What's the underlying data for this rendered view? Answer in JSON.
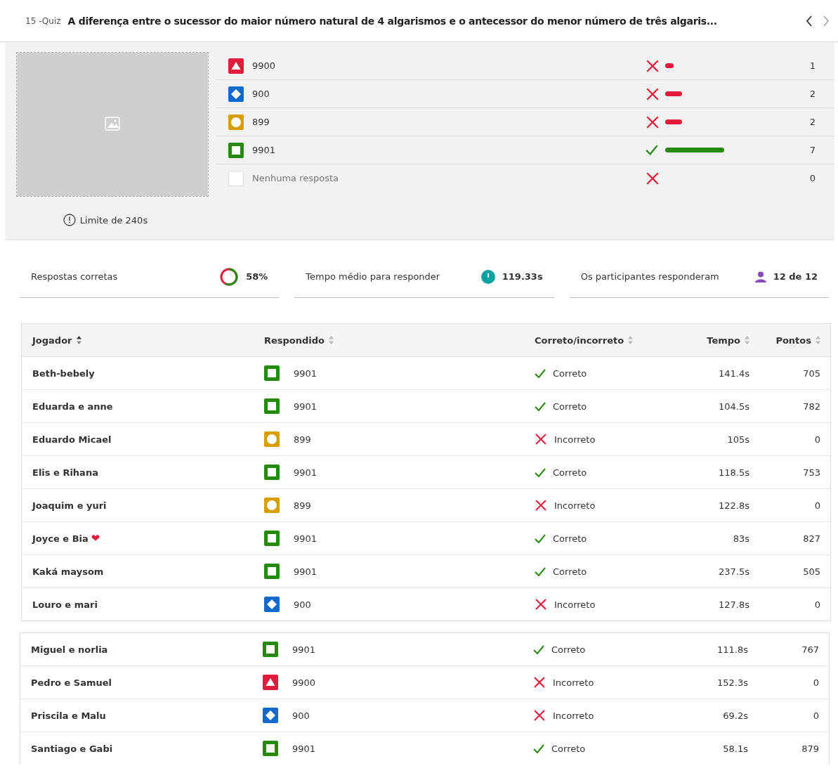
{
  "header": {
    "number": "15 -Quiz",
    "title": "A diferença entre o sucessor do maior número natural de 4 algarismos e o antecessor do menor número de três algaris..."
  },
  "question": {
    "time_limit": "Limite de 240s",
    "answers": [
      {
        "kind": "triangle",
        "color": "#e21b3c",
        "text": "9900",
        "correct": false,
        "count": "1"
      },
      {
        "kind": "diamond",
        "color": "#1368ce",
        "text": "900",
        "correct": false,
        "count": "2"
      },
      {
        "kind": "circle",
        "color": "#d89e00",
        "text": "899",
        "correct": false,
        "count": "2"
      },
      {
        "kind": "square",
        "color": "#26890c",
        "text": "9901",
        "correct": true,
        "count": "7"
      },
      {
        "kind": "none",
        "color": "#ffffff",
        "text": "Nenhuma resposta",
        "correct": false,
        "count": "0"
      }
    ]
  },
  "stats": [
    {
      "kind": "donut",
      "label": "Respostas corretas",
      "value": "58%"
    },
    {
      "kind": "clock",
      "label": "Tempo médio para responder",
      "value": "119.33s"
    },
    {
      "kind": "person",
      "label": "Os participantes responderam",
      "value": "12 de 12"
    }
  ],
  "table": {
    "columns": [
      {
        "label": "Jogador",
        "sorted": true
      },
      {
        "label": "Respondido",
        "sorted": false
      },
      {
        "label": "Correto/incorreto",
        "sorted": false
      },
      {
        "label": "Tempo",
        "sorted": false
      },
      {
        "label": "Pontos",
        "sorted": false
      }
    ],
    "rows": [
      {
        "player": "Beth-bebely",
        "kind": "square",
        "color": "#26890c",
        "answer": "9901",
        "correct": true,
        "result": "Correto",
        "time": "141.4s",
        "points": "705"
      },
      {
        "player": "Eduarda e anne",
        "kind": "square",
        "color": "#26890c",
        "answer": "9901",
        "correct": true,
        "result": "Correto",
        "time": "104.5s",
        "points": "782"
      },
      {
        "player": "Eduardo Micael",
        "kind": "circle",
        "color": "#d89e00",
        "answer": "899",
        "correct": false,
        "result": "Incorreto",
        "time": "105s",
        "points": "0"
      },
      {
        "player": "Elis e Rihana",
        "kind": "square",
        "color": "#26890c",
        "answer": "9901",
        "correct": true,
        "result": "Correto",
        "time": "118.5s",
        "points": "753"
      },
      {
        "player": "Joaquim e yuri",
        "kind": "circle",
        "color": "#d89e00",
        "answer": "899",
        "correct": false,
        "result": "Incorreto",
        "time": "122.8s",
        "points": "0"
      },
      {
        "player": "Joyce e Bia",
        "suffix": "❤",
        "kind": "square",
        "color": "#26890c",
        "answer": "9901",
        "correct": true,
        "result": "Correto",
        "time": "83s",
        "points": "827"
      },
      {
        "player": "Kaká maysom",
        "kind": "square",
        "color": "#26890c",
        "answer": "9901",
        "correct": true,
        "result": "Correto",
        "time": "237.5s",
        "points": "505"
      },
      {
        "player": "Louro e mari",
        "kind": "diamond",
        "color": "#1368ce",
        "answer": "900",
        "correct": false,
        "result": "Incorreto",
        "time": "127.8s",
        "points": "0"
      }
    ]
  },
  "table_continued": {
    "rows": [
      {
        "player": "Miguel e norlia",
        "kind": "square",
        "color": "#26890c",
        "answer": "9901",
        "correct": true,
        "result": "Correto",
        "time": "111.8s",
        "points": "767"
      },
      {
        "player": "Pedro e Samuel",
        "kind": "triangle",
        "color": "#e21b3c",
        "answer": "9900",
        "correct": false,
        "result": "Incorreto",
        "time": "152.3s",
        "points": "0"
      },
      {
        "player": "Priscila e Malu",
        "kind": "diamond",
        "color": "#1368ce",
        "answer": "900",
        "correct": false,
        "result": "Incorreto",
        "time": "69.2s",
        "points": "0"
      },
      {
        "player": "Santiago e Gabi",
        "kind": "square",
        "color": "#26890c",
        "answer": "9901",
        "correct": true,
        "result": "Correto",
        "time": "58.1s",
        "points": "879"
      }
    ]
  }
}
